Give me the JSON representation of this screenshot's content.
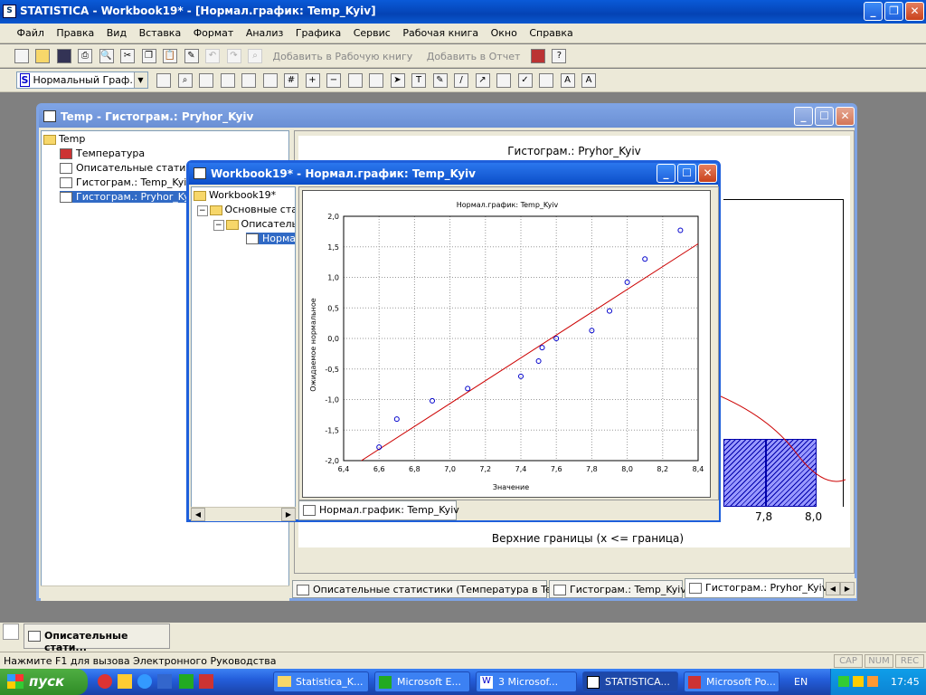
{
  "app": {
    "title": "STATISTICA - Workbook19* - [Нормал.график: Temp_Kyiv]"
  },
  "menu": [
    "Файл",
    "Правка",
    "Вид",
    "Вставка",
    "Формат",
    "Анализ",
    "Графика",
    "Сервис",
    "Рабочая книга",
    "Окно",
    "Справка"
  ],
  "toolbar1": {
    "add_workbook": "Добавить в Рабочую книгу",
    "add_report": "Добавить в Отчет"
  },
  "toolbar2": {
    "graph_select": "Нормальный Граф..."
  },
  "back_window": {
    "title": "Temp - Гистограм.: Pryhor_Kyiv",
    "tree": {
      "root": "Temp",
      "items": [
        "Температура",
        "Описательные статистики",
        "Гистограм.: Temp_Kyiv",
        "Гистограм.: Pryhor_Kyiv"
      ]
    },
    "chart_title": "Гистограм.: Pryhor_Kyiv",
    "x_label": "Верхние границы (x <= граница)",
    "x_ticks": [
      "7,8",
      "8,0"
    ],
    "tabs": [
      "Описательные статистики (Температура в Temp)",
      "Гистограм.: Temp_Kyiv",
      "Гистограм.: Pryhor_Kyiv"
    ]
  },
  "front_window": {
    "title": "Workbook19* - Нормал.график: Temp_Kyiv",
    "tree": {
      "root": "Workbook19*",
      "items": [
        "Основные стат",
        "Описательн",
        "Нормал"
      ]
    },
    "tab": "Нормал.график: Temp_Kyiv"
  },
  "chart_data": {
    "type": "scatter",
    "title": "Нормал.график: Temp_Kyiv",
    "xlabel": "Значение",
    "ylabel": "Ожидаемое нормальное",
    "xlim": [
      6.4,
      8.4
    ],
    "ylim": [
      -2.0,
      2.0
    ],
    "x_ticks": [
      "6,4",
      "6,6",
      "6,8",
      "7,0",
      "7,2",
      "7,4",
      "7,6",
      "7,8",
      "8,0",
      "8,2",
      "8,4"
    ],
    "y_ticks": [
      "2,0",
      "1,5",
      "1,0",
      "0,5",
      "0,0",
      "-0,5",
      "-1,0",
      "-1,5",
      "-2,0"
    ],
    "points": [
      [
        6.6,
        -1.78
      ],
      [
        6.7,
        -1.32
      ],
      [
        6.9,
        -1.02
      ],
      [
        7.1,
        -0.82
      ],
      [
        7.4,
        -0.62
      ],
      [
        7.5,
        -0.37
      ],
      [
        7.52,
        -0.15
      ],
      [
        7.6,
        0.0
      ],
      [
        7.8,
        0.13
      ],
      [
        7.9,
        0.45
      ],
      [
        8.0,
        0.92
      ],
      [
        8.1,
        1.3
      ],
      [
        8.3,
        1.77
      ]
    ],
    "fit_line": [
      [
        6.5,
        -2.0
      ],
      [
        8.4,
        1.55
      ]
    ],
    "grid": true,
    "point_color": "#0000cc",
    "line_color": "#cc0000"
  },
  "status": {
    "text": "Нажмите F1 для вызова Электронного Руководства",
    "caps": "CAP",
    "num": "NUM",
    "rec": "REC"
  },
  "minimized": "Описательные стати...",
  "taskbar": {
    "start": "пуск",
    "buttons": [
      "Statistica_K...",
      "Microsoft E...",
      "3 Microsof...",
      "STATISTICA...",
      "Microsoft Po..."
    ],
    "lang": "EN",
    "time": "17:45"
  }
}
